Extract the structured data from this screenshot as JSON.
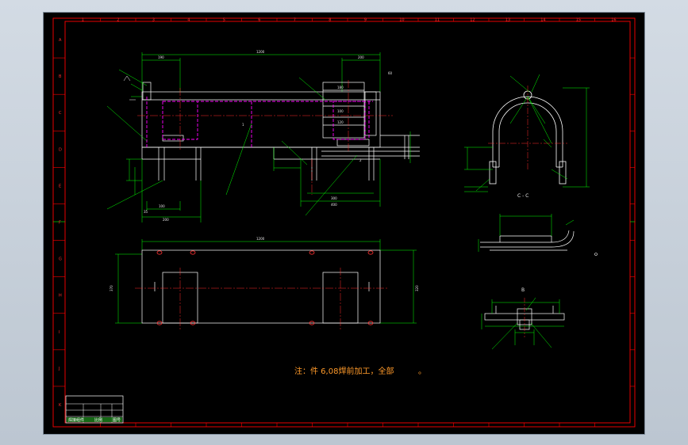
{
  "drawing": {
    "note": "注：件 6,08焊前加工，全部",
    "note_dot": "。",
    "section_cc": "C - C",
    "view_b": "B",
    "top_view": {
      "overall": "1200",
      "left_a": "190",
      "right_a": "200",
      "side": "60",
      "label_1": "1",
      "label_2": "2",
      "inner_a": "180",
      "inner_b": "100",
      "inner_c": "120",
      "left_b": "100",
      "left_c": "200",
      "left_d": "35",
      "right_b": "300",
      "right_c": "400"
    },
    "plan_view": {
      "overall": "1200",
      "height_left": "370",
      "height_right": "320"
    },
    "colors": {
      "frame": "#ff0000",
      "geometry": "#ffffff",
      "dimension": "#00ff00",
      "hidden": "#ff00ff",
      "centerline": "#ff2a2a",
      "leader": "#00ff00",
      "note": "#ff9a2a"
    }
  },
  "title_block": {
    "line1": "焊接组件",
    "line2": "比例",
    "line3": "图号"
  },
  "frame_ticks": {
    "top": [
      "1",
      "2",
      "3",
      "4",
      "5",
      "6",
      "7",
      "8",
      "9",
      "10",
      "11",
      "12",
      "13",
      "14",
      "15",
      "16"
    ],
    "left": [
      "A",
      "B",
      "C",
      "D",
      "E",
      "F",
      "G",
      "H",
      "I",
      "J",
      "K"
    ]
  }
}
